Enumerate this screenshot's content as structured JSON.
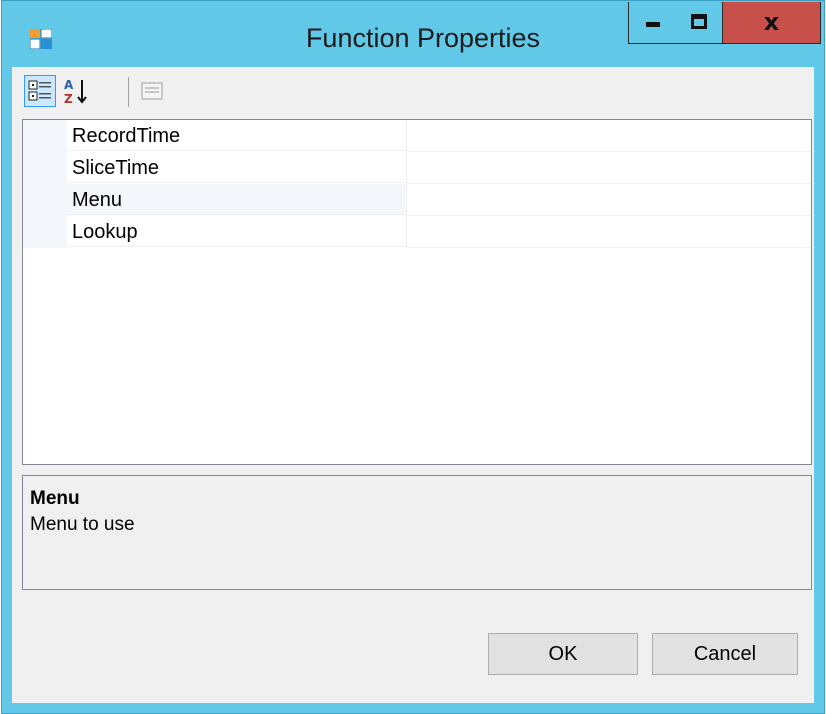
{
  "window": {
    "title": "Function Properties",
    "close_glyph": "x"
  },
  "toolbar": {
    "items": [
      {
        "icon": "categorized-icon",
        "tooltip": "Categorized",
        "active": true
      },
      {
        "icon": "alphabetical-sort-icon",
        "tooltip": "Alphabetical",
        "active": false
      },
      {
        "icon": "property-pages-icon",
        "tooltip": "Property Pages",
        "enabled": false
      }
    ]
  },
  "properties": [
    {
      "name": "RecordTime",
      "value": ""
    },
    {
      "name": "SliceTime",
      "value": ""
    },
    {
      "name": "Menu",
      "value": "",
      "selected": true
    },
    {
      "name": "Lookup",
      "value": ""
    }
  ],
  "help": {
    "title": "Menu",
    "description": "Menu to use"
  },
  "buttons": {
    "ok": "OK",
    "cancel": "Cancel"
  },
  "colors": {
    "titlebar": "#62c8e8",
    "close_button": "#c7504a",
    "client_bg": "#f0f0f0",
    "grid_margin": "#f4f7fc"
  }
}
